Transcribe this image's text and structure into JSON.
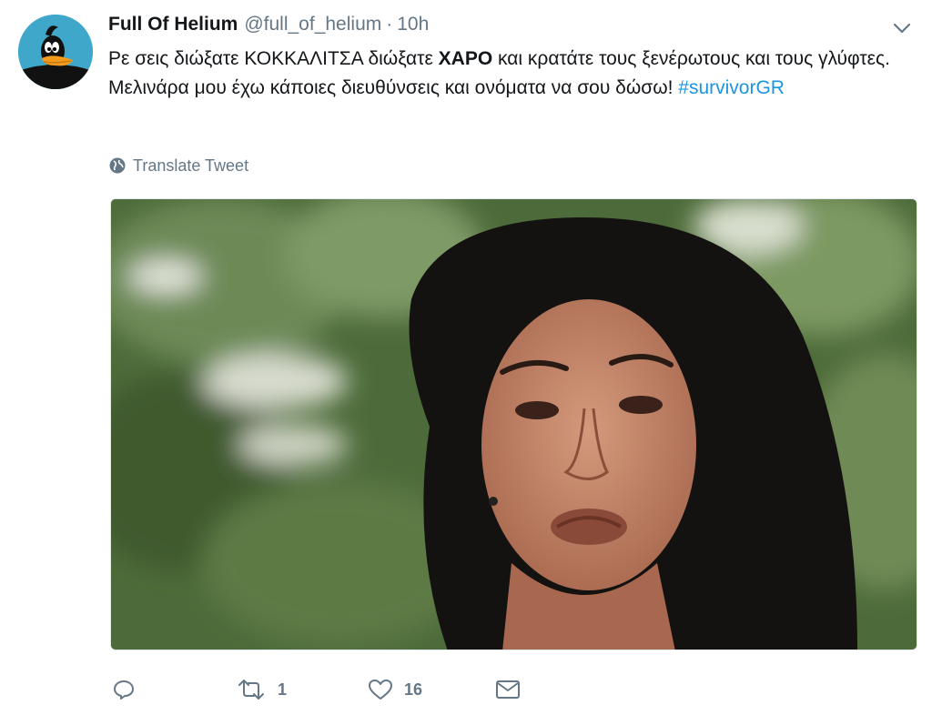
{
  "tweet": {
    "author_name": "Full Of Helium",
    "author_handle": "@full_of_helium",
    "separator": "·",
    "time": "10h",
    "text_part1": "Ρε σεις διώξατε ΚΟΚΚΑΛΙΤΣΑ διώξατε ",
    "text_bold": "ΧΑΡΟ",
    "text_part2": " και κρατάτε τους ξενέρωτους και τους γλύφτες. Μελινάρα μου έχω κάποιες διευθύνσεις και ονόματα να σου δώσω! ",
    "hashtag": "#survivorGR",
    "translate_label": "Translate Tweet"
  },
  "actions": {
    "reply_count": "",
    "retweet_count": "1",
    "like_count": "16"
  },
  "icons": {
    "avatar": "daffy-duck-avatar",
    "caret": "chevron-down-icon",
    "globe": "globe-icon",
    "reply": "reply-icon",
    "retweet": "retweet-icon",
    "like": "heart-icon",
    "message": "envelope-icon"
  },
  "colors": {
    "text": "#14171a",
    "secondary": "#657786",
    "link": "#1b95e0",
    "avatar_bg": "#3fa7c9"
  }
}
